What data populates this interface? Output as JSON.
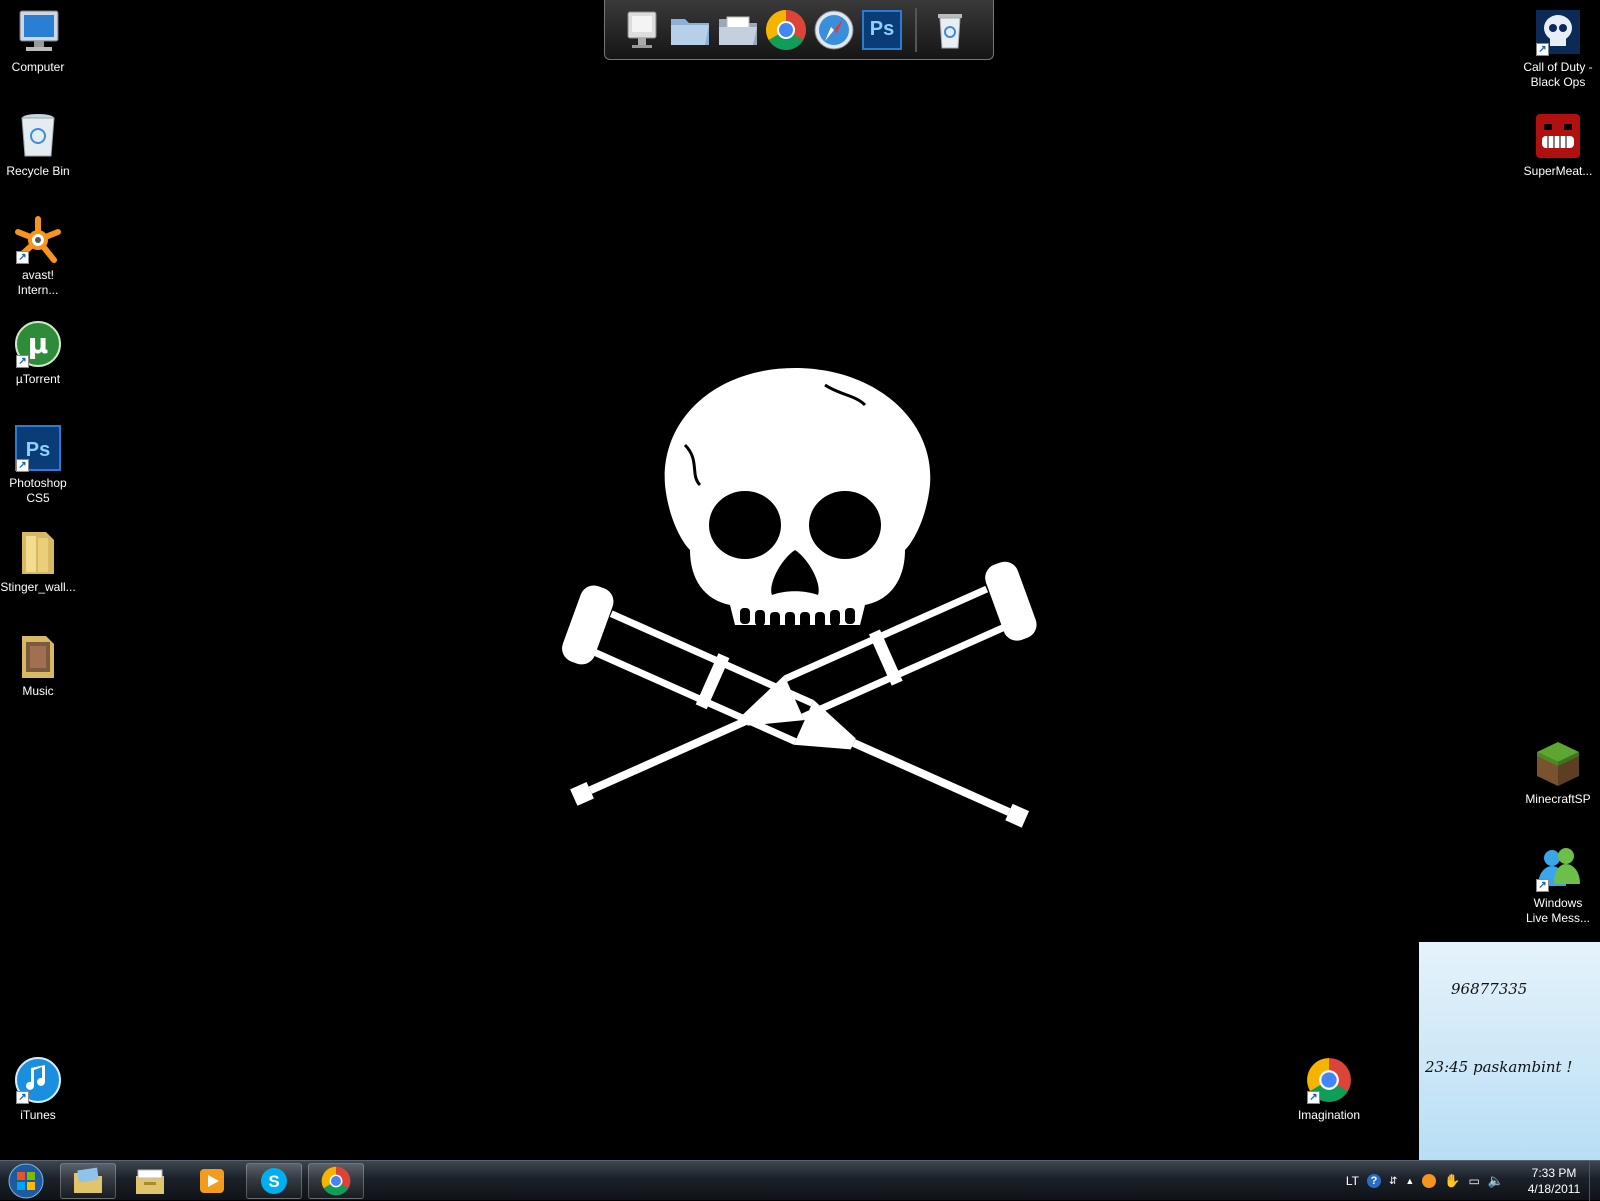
{
  "desktop": {
    "background": "#000000",
    "left_icons": [
      {
        "label": "Computer"
      },
      {
        "label": "Recycle Bin"
      },
      {
        "label": "avast!\nIntern..."
      },
      {
        "label": "µTorrent"
      },
      {
        "label": "Photoshop\nCS5"
      },
      {
        "label": "Stinger_wall..."
      },
      {
        "label": "Music"
      },
      {
        "label": "iTunes"
      }
    ],
    "right_icons": [
      {
        "label": "Call of Duty -\nBlack Ops"
      },
      {
        "label": "SuperMeat..."
      },
      {
        "label": "MinecraftSP"
      },
      {
        "label": "Windows\nLive Mess..."
      },
      {
        "label": "Imagination"
      }
    ]
  },
  "dock": {
    "items": [
      "monitor-icon",
      "folder-icon",
      "folder-open-icon",
      "chrome-icon",
      "safari-icon",
      "photoshop-icon",
      "recycle-bin-icon"
    ],
    "ps_label": "Ps"
  },
  "sticky_note": {
    "line1": "96877335",
    "line2": "23:45 paskambint !"
  },
  "taskbar": {
    "apps": [
      "explorer-icon",
      "file-manager-icon",
      "media-player-icon",
      "skype-icon",
      "chrome-icon"
    ],
    "tray": {
      "language": "LT",
      "help": "?"
    },
    "clock": {
      "time": "7:33 PM",
      "date": "4/18/2011"
    }
  }
}
